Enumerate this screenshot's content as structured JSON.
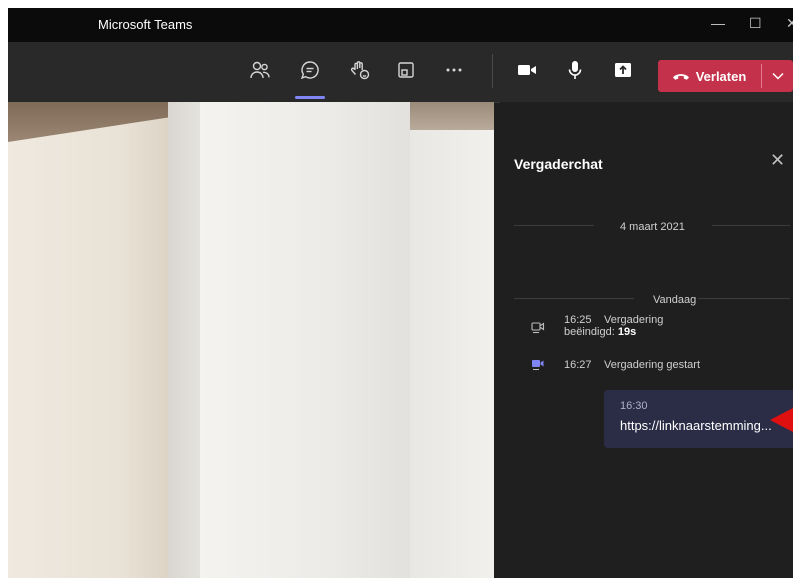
{
  "window": {
    "title": "Microsoft Teams",
    "controls": {
      "minimize": "—",
      "maximize": "☐",
      "close": "✕"
    }
  },
  "toolbar": {
    "leave_label": "Verlaten",
    "accent": "#7f85f5",
    "leave_color": "#c4314b",
    "icons": [
      "people-icon",
      "chat-icon",
      "raise-hand-icon",
      "breakout-rooms-icon",
      "more-icon",
      "camera-icon",
      "microphone-icon",
      "share-icon"
    ]
  },
  "chat": {
    "title": "Vergaderchat",
    "close": "✕",
    "date_separator": "4 maart 2021",
    "today_separator": "Vandaag",
    "events": [
      {
        "time": "16:25",
        "text_line1": "Vergadering",
        "text_line2": "beëindigd:",
        "duration": "19s"
      },
      {
        "time": "16:27",
        "text": "Vergadering gestart"
      }
    ],
    "message": {
      "time": "16:30",
      "text": "https://linknaarstemming..."
    }
  }
}
